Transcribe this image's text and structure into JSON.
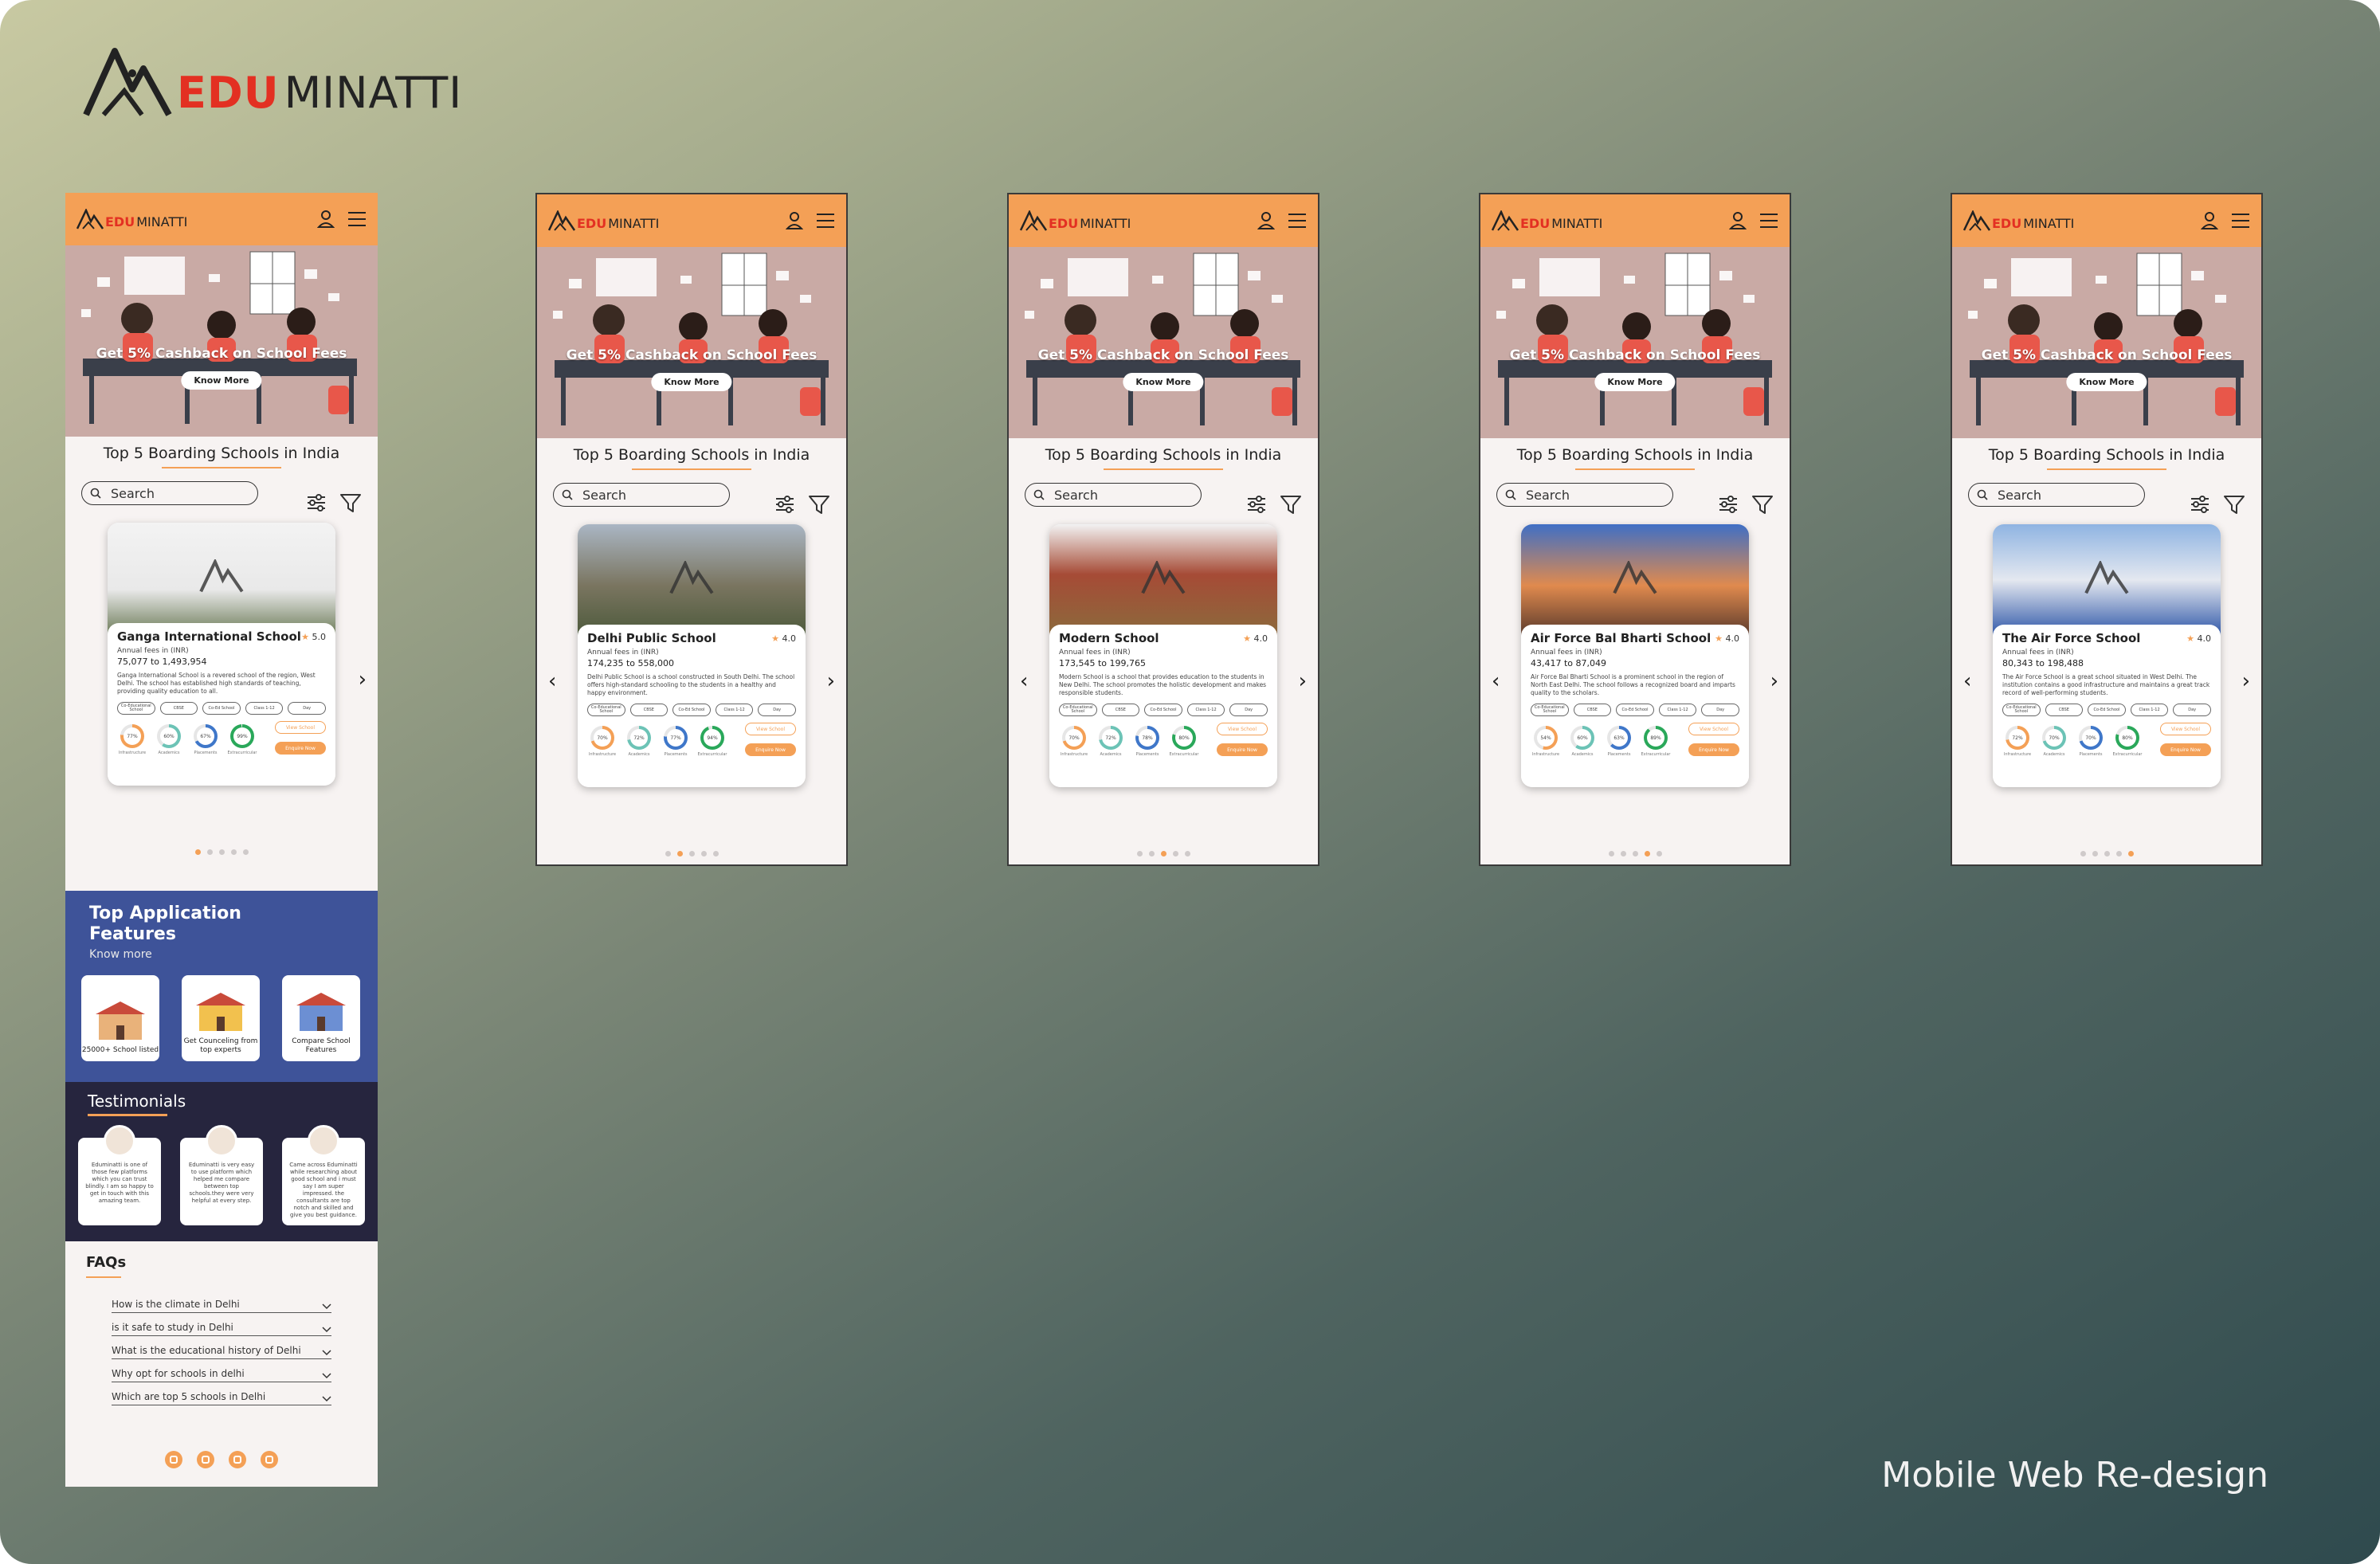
{
  "brand": {
    "word_red": "EDU",
    "word_dark": "MINATTI"
  },
  "caption": "Mobile Web Re-design",
  "colors": {
    "orange": "#f4a056",
    "red": "#e33022",
    "navy": "#3e5399",
    "dark": "#26253e"
  },
  "header": {
    "logo_red": "EDU",
    "logo_dark": "MINATTI",
    "icons": [
      "user-icon",
      "menu-icon"
    ]
  },
  "banner": {
    "title": "Get 5% Cashback on School Fees",
    "button": "Know More"
  },
  "list": {
    "title": "Top 5 Boarding Schools in India",
    "search_placeholder": "Search",
    "icons": [
      "sliders-icon",
      "filter-icon"
    ]
  },
  "chip_labels": [
    "Co-Educational School",
    "CBSE",
    "Co-Ed School",
    "Class 1-12",
    "Day"
  ],
  "stat_labels": [
    "Infrastructure",
    "Academics",
    "Placements",
    "Extracurricular"
  ],
  "card_buttons": {
    "view": "View School",
    "enquire": "Enquire Now"
  },
  "schools": [
    {
      "name": "Ganga International School",
      "rating": "5.0",
      "fees_label": "Annual fees in (INR)",
      "fees": "75,077 to 1,493,954",
      "desc": "Ganga International School is a revered school of the region, West Delhi. The school has established high standards of teaching, providing quality education to all.",
      "stats": [
        "77%",
        "60%",
        "67%",
        "99%"
      ],
      "active_dot": 0
    },
    {
      "name": "Delhi  Public School",
      "rating": "4.0",
      "fees_label": "Annual fees in (INR)",
      "fees": "174,235 to 558,000",
      "desc": "Delhi Public School is a school constructed in South Delhi. The school offers high-standard schooling to the students in a healthy and happy environment.",
      "stats": [
        "70%",
        "72%",
        "77%",
        "94%"
      ],
      "active_dot": 1
    },
    {
      "name": "Modern School",
      "rating": "4.0",
      "fees_label": "Annual fees in (INR)",
      "fees": "173,545 to 199,765",
      "desc": "Modern School is a school that provides education to the students in New Delhi. The school promotes the holistic development and makes responsible students.",
      "stats": [
        "70%",
        "72%",
        "78%",
        "80%"
      ],
      "active_dot": 2
    },
    {
      "name": "Air Force Bal Bharti School",
      "rating": "4.0",
      "fees_label": "Annual fees in (INR)",
      "fees": "43,417 to 87,049",
      "desc": "Air Force Bal Bharti School is a prominent school in the region of North East Delhi. The school follows a recognized board and imparts quality to the scholars.",
      "stats": [
        "54%",
        "60%",
        "63%",
        "89%"
      ],
      "active_dot": 3
    },
    {
      "name": "The Air Force School",
      "rating": "4.0",
      "fees_label": "Annual fees in (INR)",
      "fees": "80,343 to 198,488",
      "desc": "The Air Force School is a great school situated in West Delhi. The institution contains a good infrastructure and maintains a great track record of well-performing students.",
      "stats": [
        "72%",
        "70%",
        "70%",
        "80%"
      ],
      "active_dot": 4
    }
  ],
  "features": {
    "title": "Top Application Features",
    "link": "Know more",
    "items": [
      {
        "label": "25000+ School listed"
      },
      {
        "label": "Get Counceling from top experts"
      },
      {
        "label": "Compare School Features"
      }
    ]
  },
  "testimonials": {
    "title": "Testimonials",
    "items": [
      "Eduminatti is one of those few platforms which you can trust blindly. I am so happy to get in touch with this amazing team.",
      "Eduminatti is very easy to use platform which helped me compare between top schools.they were very helpful at every step.",
      "Came across Eduminatti while researching about good school and i must say I am super impressed. the consultants are top notch and skilled and give you best guidance."
    ]
  },
  "faq": {
    "title": "FAQs",
    "items": [
      "How is the climate in Delhi",
      "is it safe to study in Delhi",
      "What is the educational history of Delhi",
      "Why opt for schools in delhi",
      "Which are top 5 schools in Delhi"
    ]
  },
  "social": [
    "facebook-icon",
    "instagram-icon",
    "twitter-icon",
    "youtube-icon"
  ]
}
